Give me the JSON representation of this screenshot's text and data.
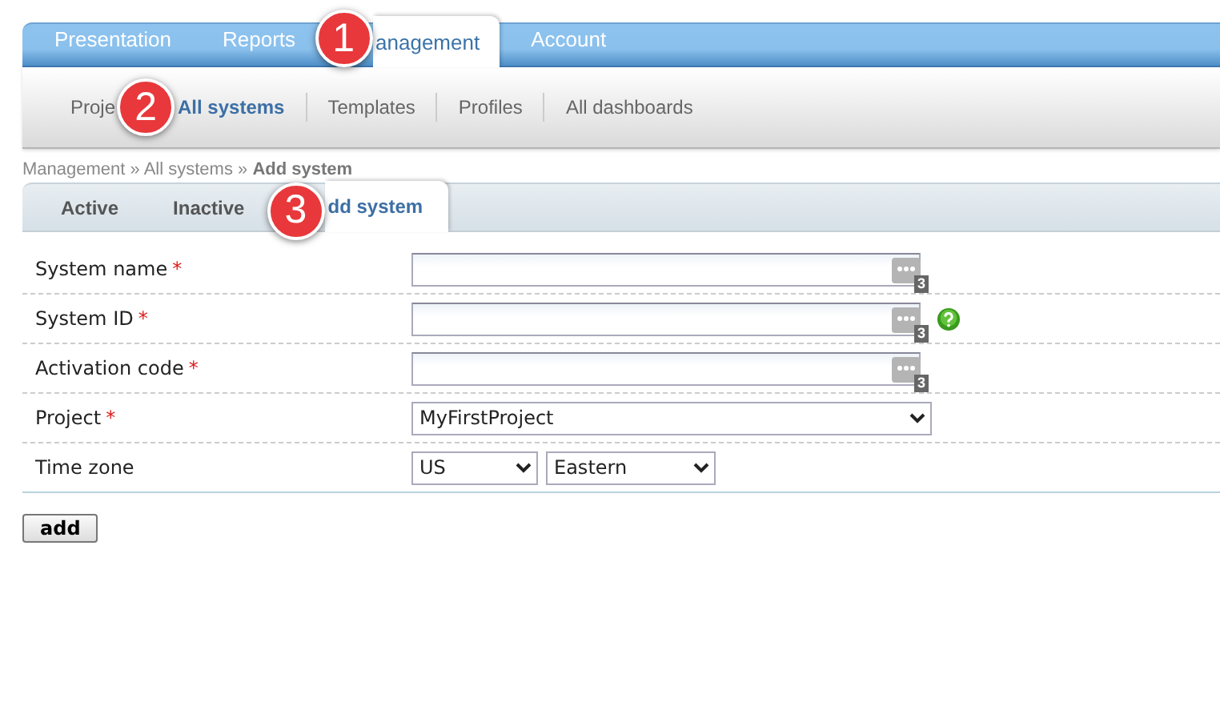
{
  "nav": {
    "tabs": [
      {
        "label": "Presentation",
        "selected": false
      },
      {
        "label": "Reports",
        "selected": false
      },
      {
        "label": "anagement",
        "selected": true
      },
      {
        "label": "Account",
        "selected": false
      }
    ]
  },
  "subnav": {
    "items": [
      {
        "label": "Proje",
        "selected": false
      },
      {
        "label": "All systems",
        "selected": true
      },
      {
        "label": "Templates",
        "selected": false
      },
      {
        "label": "Profiles",
        "selected": false
      },
      {
        "label": "All dashboards",
        "selected": false
      }
    ]
  },
  "breadcrumb": "Management » All systems » **Add system**",
  "subtabs": [
    {
      "label": "Active",
      "selected": false
    },
    {
      "label": "Inactive",
      "selected": false
    },
    {
      "label": "dd system",
      "selected": true
    }
  ],
  "form": {
    "rows": [
      {
        "kind": "text",
        "label": "System name",
        "required_mark": "*",
        "counter": "3",
        "help": false
      },
      {
        "kind": "text",
        "label": "System ID",
        "required_mark": "*",
        "counter": "3",
        "help": true
      },
      {
        "kind": "text",
        "label": "Activation code",
        "required_mark": "*",
        "counter": "3",
        "help": false
      },
      {
        "kind": "select",
        "label": "Project",
        "required_mark": "*",
        "value": "MyFirstProject"
      },
      {
        "kind": "timezone",
        "label": "Time zone",
        "region": "US",
        "zone": "Eastern"
      }
    ]
  },
  "submit": "add",
  "callouts": [
    {
      "number": "1"
    },
    {
      "number": "2"
    },
    {
      "number": "3"
    }
  ]
}
